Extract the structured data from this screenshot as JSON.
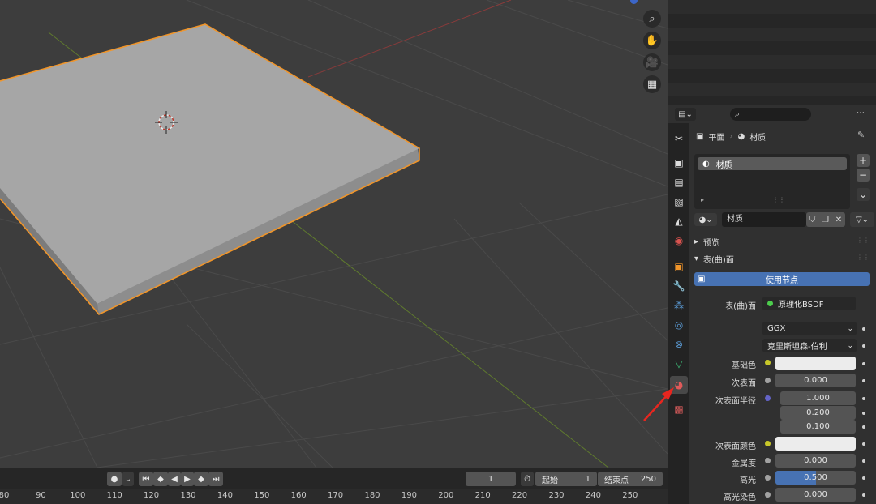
{
  "timeline": {
    "current_frame": "1",
    "start_label": "起始",
    "start_value": "1",
    "end_label": "结束点",
    "end_value": "250",
    "ruler_ticks": [
      "80",
      "90",
      "100",
      "110",
      "120",
      "130",
      "140",
      "150",
      "160",
      "170",
      "180",
      "190",
      "200",
      "210",
      "220",
      "230",
      "240",
      "250"
    ]
  },
  "properties": {
    "breadcrumb_object": "平面",
    "breadcrumb_material": "材质",
    "slot_name": "材质",
    "material_name": "材质",
    "panel_preview": "预览",
    "panel_surface": "表(曲)面",
    "use_nodes_label": "使用节点",
    "surface_label": "表(曲)面",
    "surface_value": "原理化BSDF",
    "distribution": "GGX",
    "subsurface_method": "克里斯坦森-伯利",
    "base_color_label": "基础色",
    "subsurface_label": "次表面",
    "subsurface_value": "0.000",
    "subsurface_radius_label": "次表面半径",
    "subsurface_radius": [
      "1.000",
      "0.200",
      "0.100"
    ],
    "subsurface_color_label": "次表面颜色",
    "metallic_label": "金属度",
    "metallic_value": "0.000",
    "specular_label": "高光",
    "specular_value": "0.500",
    "specular_fraction": 0.5,
    "specular_tint_label": "高光染色",
    "specular_tint_value": "0.000"
  },
  "colors": {
    "accent_blue": "#4772b3",
    "selection_orange": "#f0952a",
    "arrow_red": "#e8261f"
  },
  "icons": {
    "viewport": [
      "zoom-icon",
      "hand-pan-icon",
      "camera-icon",
      "grid-view-icon"
    ],
    "tabs": [
      "tool-icon",
      "render-icon",
      "output-icon",
      "view-layer-icon",
      "scene-icon",
      "world-icon",
      "object-icon",
      "modifier-icon",
      "particles-icon",
      "physics-icon",
      "constraints-icon",
      "object-data-icon",
      "material-icon",
      "texture-icon"
    ]
  }
}
